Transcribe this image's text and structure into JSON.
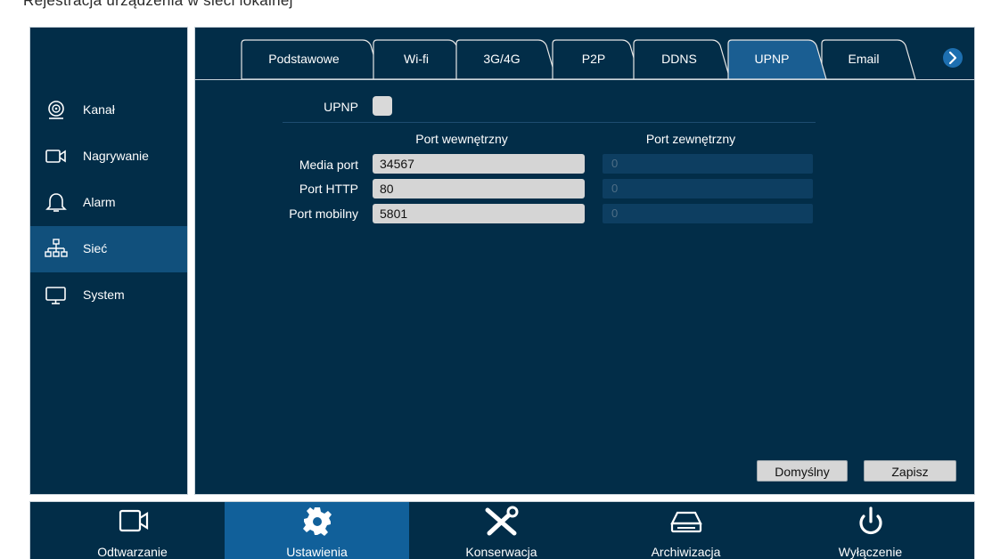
{
  "top_strip_text": "Rejestracja urządzenia w sieci lokalnej",
  "sidebar": {
    "items": [
      {
        "label": "Kanał",
        "icon": "camera-lens-icon",
        "active": false
      },
      {
        "label": "Nagrywanie",
        "icon": "video-camera-icon",
        "active": false
      },
      {
        "label": "Alarm",
        "icon": "bell-icon",
        "active": false
      },
      {
        "label": "Sieć",
        "icon": "network-icon",
        "active": true
      },
      {
        "label": "System",
        "icon": "monitor-icon",
        "active": false
      }
    ]
  },
  "tabs": [
    {
      "label": "Podstawowe",
      "active": false
    },
    {
      "label": "Wi-fi",
      "active": false
    },
    {
      "label": "3G/4G",
      "active": false
    },
    {
      "label": "P2P",
      "active": false
    },
    {
      "label": "DDNS",
      "active": false
    },
    {
      "label": "UPNP",
      "active": true
    },
    {
      "label": "Email",
      "active": false
    }
  ],
  "tabs_next_icon": "chevron-right-icon",
  "upnp": {
    "label": "UPNP",
    "enabled": false,
    "col_internal": "Port wewnętrzny",
    "col_external": "Port zewnętrzny",
    "rows": [
      {
        "label": "Media port",
        "internal": "34567",
        "external": "0"
      },
      {
        "label": "Port HTTP",
        "internal": "80",
        "external": "0"
      },
      {
        "label": "Port mobilny",
        "internal": "5801",
        "external": "0"
      }
    ]
  },
  "buttons": {
    "default": "Domyślny",
    "save": "Zapisz"
  },
  "bottom": {
    "items": [
      {
        "label": "Odtwarzanie",
        "icon": "video-camera-icon",
        "active": false
      },
      {
        "label": "Ustawienia",
        "icon": "gear-icon",
        "active": true
      },
      {
        "label": "Konserwacja",
        "icon": "wrench-screwdriver-icon",
        "active": false
      },
      {
        "label": "Archiwizacja",
        "icon": "hard-drive-icon",
        "active": false
      },
      {
        "label": "Wyłączenie",
        "icon": "power-icon",
        "active": false
      }
    ]
  },
  "colors": {
    "panel_bg": "#022d48",
    "active_item": "#11507c",
    "active_bottom": "#11609a",
    "tab_active": "#1a5e92"
  }
}
